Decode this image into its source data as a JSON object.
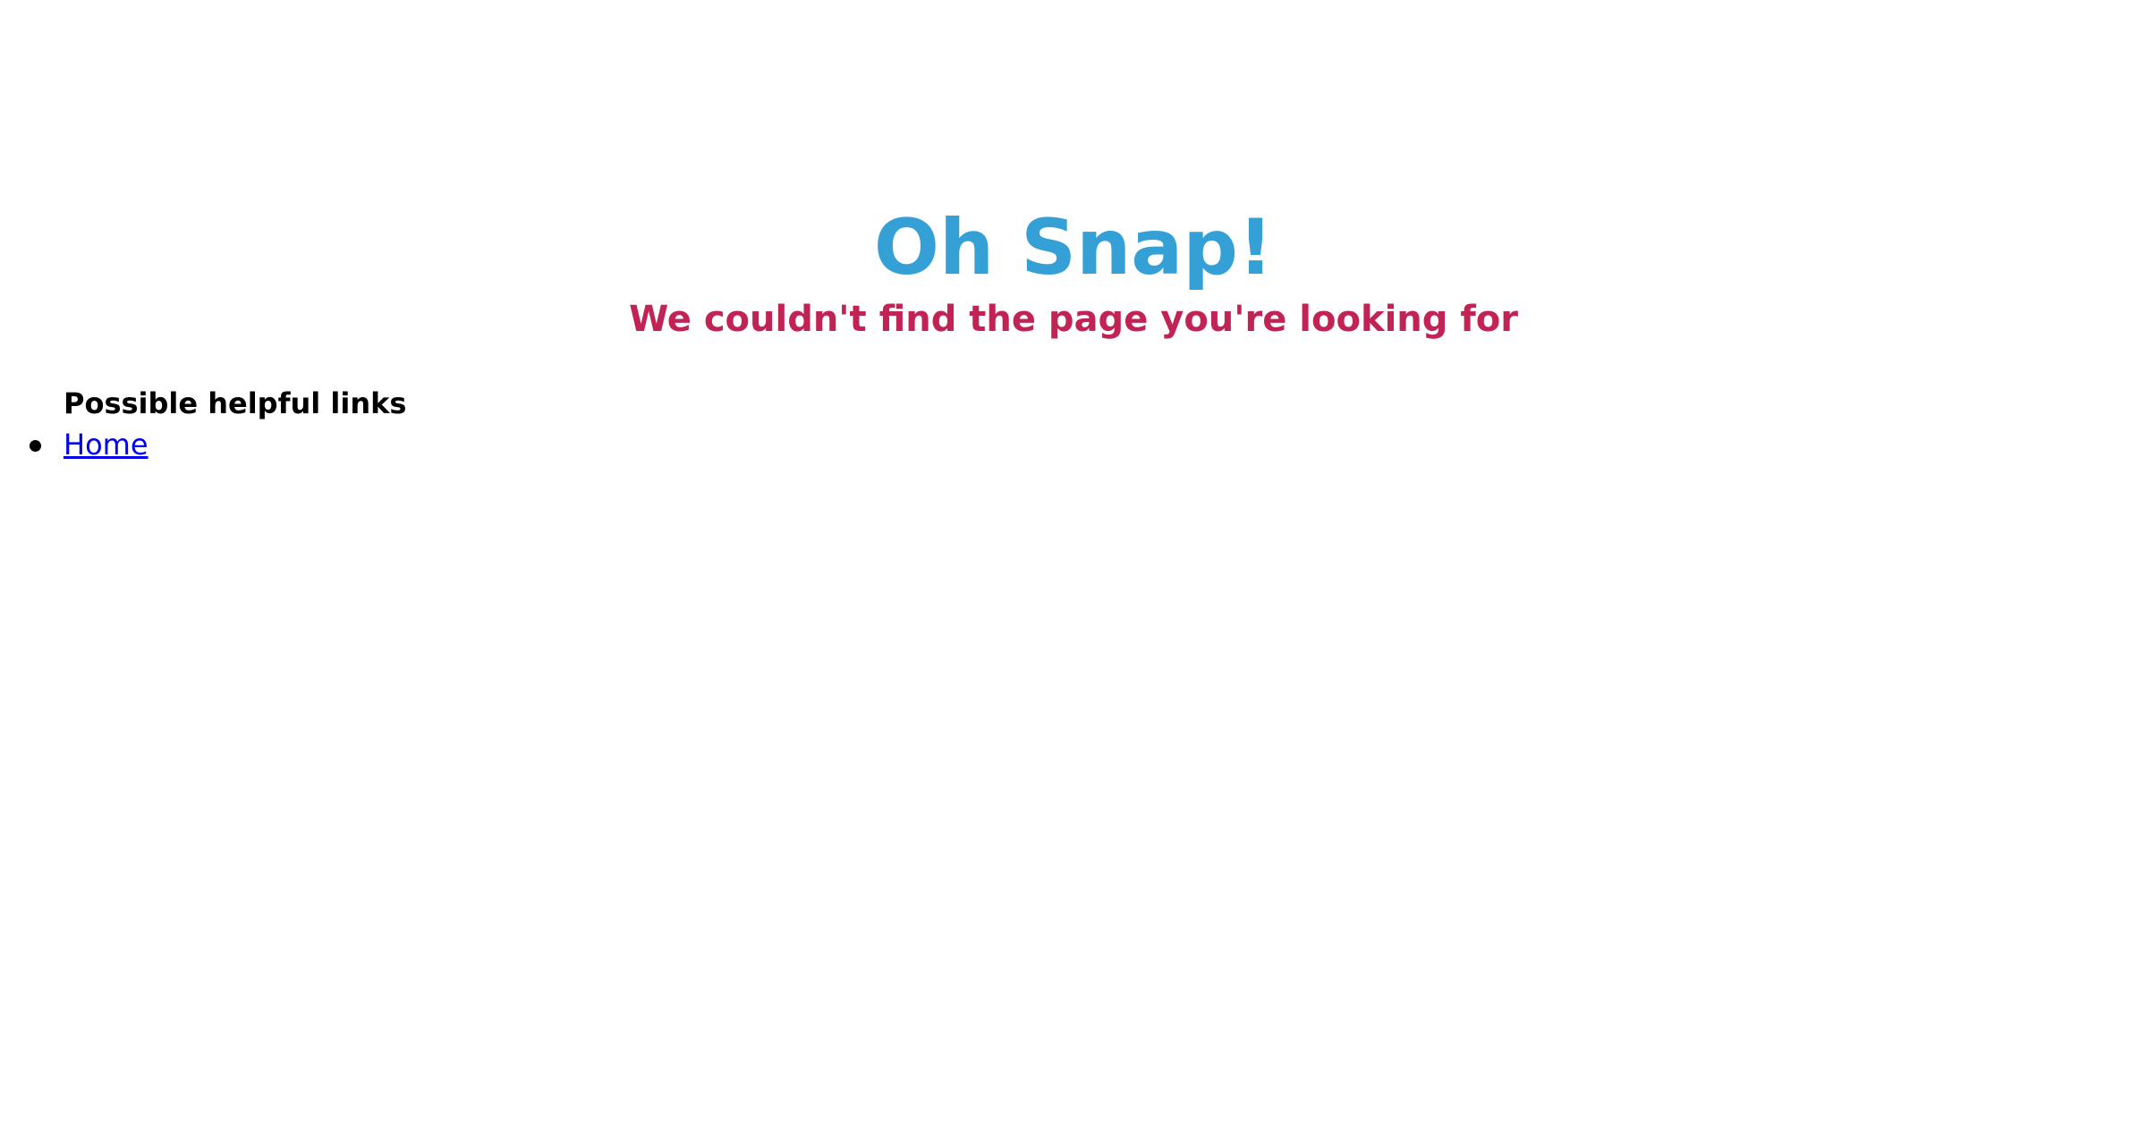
{
  "hero": {
    "title": "Oh Snap!",
    "subtitle": "We couldn't find the page you're looking for"
  },
  "links": {
    "heading": "Possible helpful links",
    "items": [
      {
        "label": "Home"
      }
    ]
  },
  "colors": {
    "title": "#35a0d6",
    "subtitle": "#c22355",
    "link": "#0000ee",
    "text": "#000000",
    "background": "#ffffff"
  }
}
